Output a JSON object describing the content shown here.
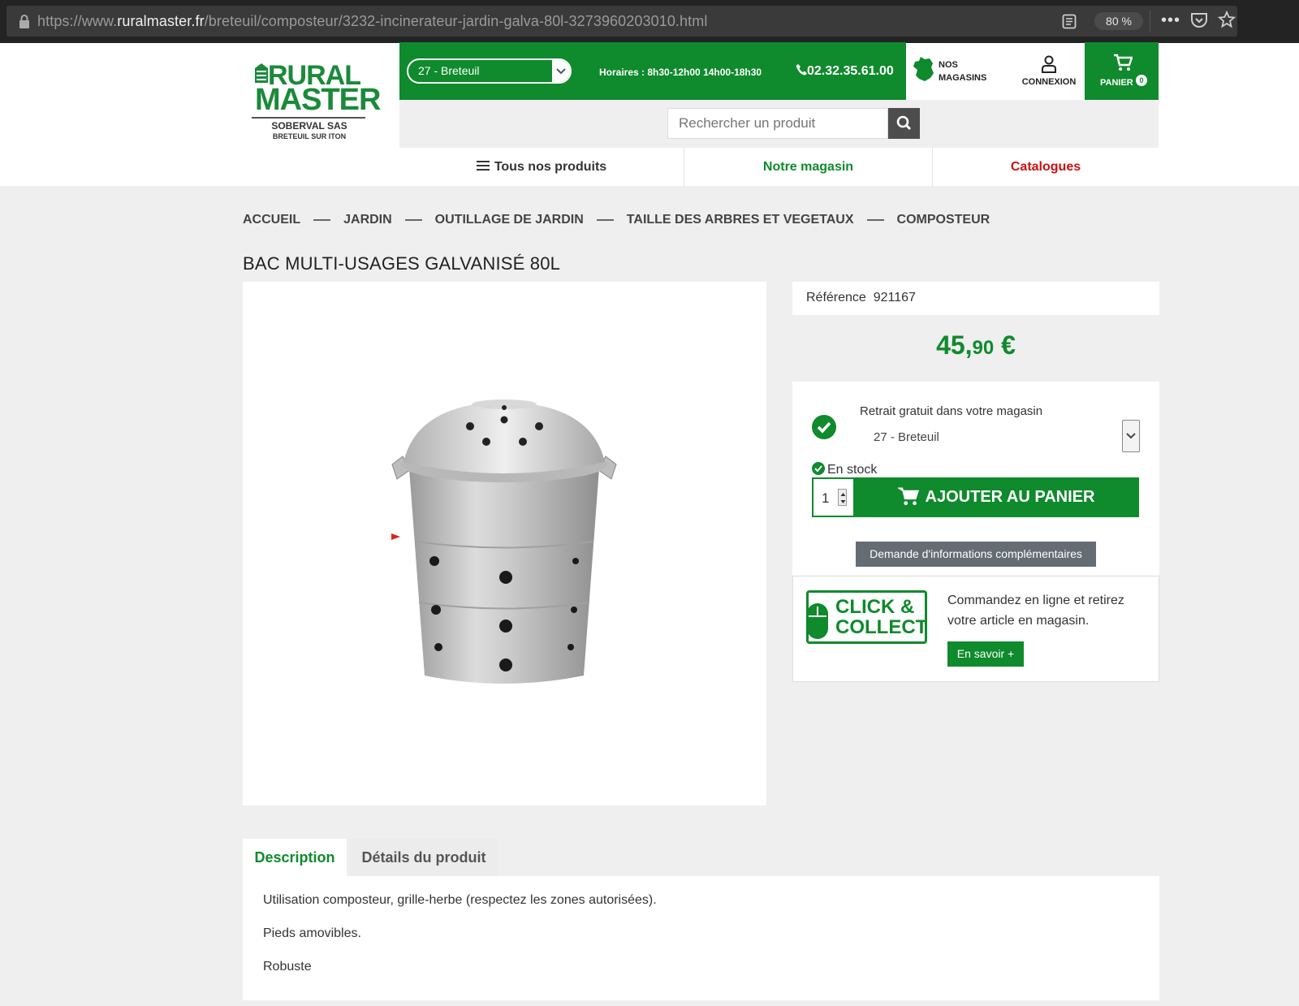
{
  "browser": {
    "url_prefix": "https://www.",
    "url_host": "ruralmaster.fr",
    "url_path": "/breteuil/composteur/3232-incinerateur-jardin-galva-80l-3273960203010.html",
    "zoom": "80 %",
    "more": "•••"
  },
  "logo": {
    "line1": "RURAL",
    "line2": "MASTER",
    "sub1": "SOBERVAL SAS",
    "sub2": "BRETEUIL SUR ITON"
  },
  "header": {
    "store": "27 - Breteuil",
    "hours": "Horaires : 8h30-12h00 14h00-18h30",
    "phone": "02.32.35.61.00",
    "stores_label_1": "NOS",
    "stores_label_2": "MAGASINS",
    "login_label": "CONNEXION",
    "cart_label": "PANIER",
    "cart_count": "0",
    "search_placeholder": "Rechercher un produit"
  },
  "nav": {
    "all_products": "Tous nos produits",
    "our_store": "Notre magasin",
    "catalogs": "Catalogues"
  },
  "breadcrumb": [
    "ACCUEIL",
    "JARDIN",
    "OUTILLAGE DE JARDIN",
    "TAILLE DES ARBRES ET VEGETAUX",
    "COMPOSTEUR"
  ],
  "product": {
    "title": "BAC MULTI-USAGES GALVANISÉ 80L",
    "reference_label": "Référence",
    "reference": "921167",
    "price_main": "45,",
    "price_cents": "90",
    "price_currency": " €"
  },
  "buy": {
    "pickup_label": "Retrait gratuit dans votre magasin",
    "pickup_store": "27 - Breteuil",
    "stock": "En stock",
    "quantity": "1",
    "add_to_cart": "AJOUTER AU PANIER",
    "info_request": "Demande d'informations complémentaires"
  },
  "click_collect": {
    "logo_line1": "CLICK &",
    "logo_line2": "COLLECT",
    "description": "Commandez en ligne et retirez votre article en magasin.",
    "more": "En savoir +"
  },
  "tabs": {
    "description": "Description",
    "details": "Détails du produit"
  },
  "description": {
    "line1": "Utilisation composteur, grille-herbe (respectez les zones autorisées).",
    "line2": "Pieds amovibles.",
    "line3": "Robuste"
  },
  "colors": {
    "brand_green": "#0f8a2c",
    "catalog_red": "#cc1111"
  }
}
